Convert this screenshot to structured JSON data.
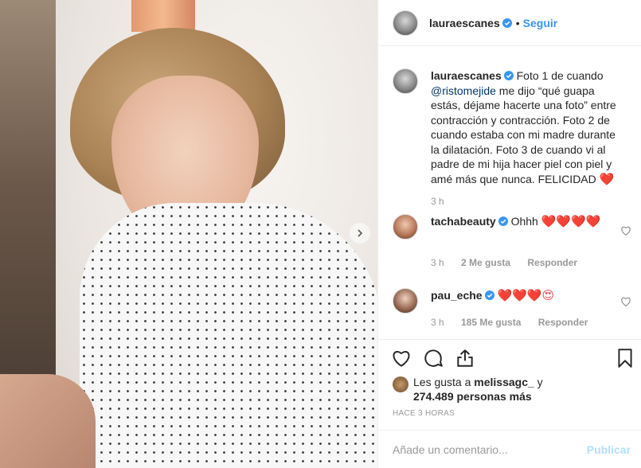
{
  "post": {
    "author": "lauraescanes",
    "dot": "•",
    "follow_label": "Seguir",
    "caption_author": "lauraescanes",
    "caption_before_mention": " Foto 1 de cuando ",
    "caption_mention": "@ristomejide",
    "caption_after_mention": " me dijo “qué guapa estás, déjame hacerte una foto” entre contracción y contracción. Foto 2 de cuando estaba con mi madre durante la dilatación. Foto 3 de cuando vi al padre de mi hija hacer piel con piel y amé más que nunca. FELICIDAD ",
    "caption_emoji": "❤️",
    "caption_time": "3 h"
  },
  "comments": [
    {
      "user": "tachabeauty",
      "text": " Ohhh ",
      "emojis": "❤️❤️❤️❤️",
      "time": "3 h",
      "likes": "2 Me gusta",
      "reply": "Responder"
    },
    {
      "user": "pau_eche",
      "text": " ",
      "emojis": "❤️❤️❤️😍",
      "time": "3 h",
      "likes": "185 Me gusta",
      "reply": "Responder"
    }
  ],
  "likes": {
    "prefix": "Les gusta a ",
    "user": "melissagc_",
    "middle": " y",
    "count": "274.489 personas más"
  },
  "timestamp": "HACE 3 HORAS",
  "composer": {
    "placeholder": "Añade un comentario...",
    "publish_label": "Publicar"
  },
  "colors": {
    "link": "#3897f0",
    "publish_disabled": "#b2dffc",
    "heart": "#ed4956",
    "muted": "#999999"
  }
}
